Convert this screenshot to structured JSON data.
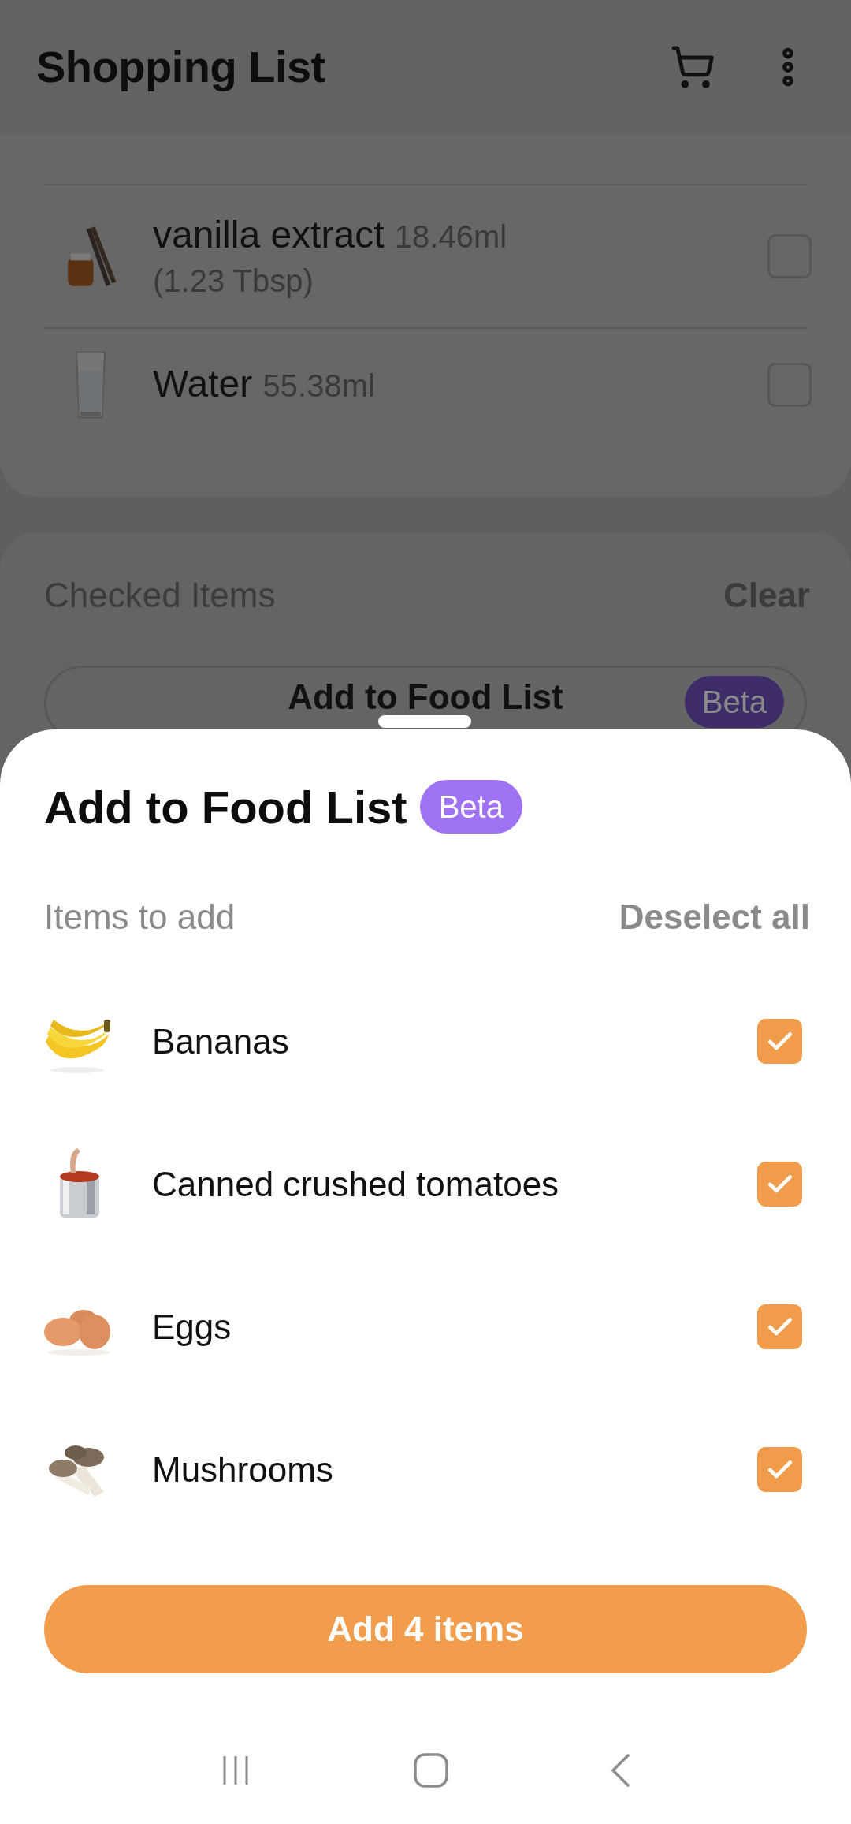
{
  "header": {
    "title": "Shopping List"
  },
  "list": {
    "items": [
      {
        "name": "vanilla extract",
        "amount": "18.46ml",
        "detail": "(1.23 Tbsp)",
        "checked": false
      },
      {
        "name": "Water",
        "amount": "55.38ml",
        "checked": false
      }
    ]
  },
  "checked_section": {
    "title": "Checked Items",
    "clear": "Clear",
    "button": {
      "label": "Add to Food List",
      "badge": "Beta"
    }
  },
  "sheet": {
    "title": "Add to Food List",
    "badge": "Beta",
    "subtitle": "Items to add",
    "deselect": "Deselect all",
    "items": [
      {
        "name": "Bananas",
        "checked": true
      },
      {
        "name": "Canned crushed tomatoes",
        "checked": true
      },
      {
        "name": "Eggs",
        "checked": true
      },
      {
        "name": "Mushrooms",
        "checked": true
      }
    ],
    "button": "Add 4 items"
  }
}
